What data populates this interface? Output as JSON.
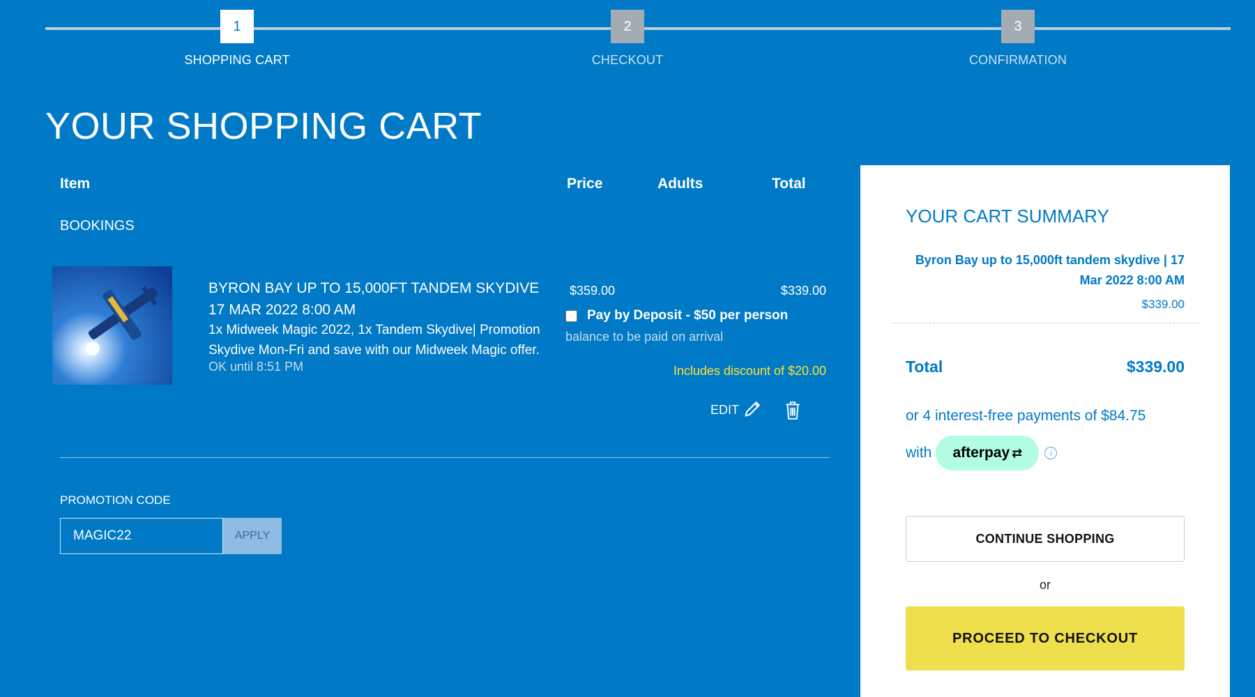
{
  "steps": [
    {
      "number": "1",
      "label": "SHOPPING CART",
      "active": true
    },
    {
      "number": "2",
      "label": "CHECKOUT",
      "active": false
    },
    {
      "number": "3",
      "label": "CONFIRMATION",
      "active": false
    }
  ],
  "page_title": "YOUR SHOPPING CART",
  "table": {
    "col_item": "Item",
    "col_price": "Price",
    "col_adults": "Adults",
    "col_total": "Total",
    "section_label": "BOOKINGS"
  },
  "item": {
    "title_line1": "BYRON BAY UP TO 15,000FT TANDEM SKYDIVE",
    "title_line2": "17 MAR 2022 8:00 AM",
    "description": "1x Midweek Magic 2022, 1x Tandem Skydive| Promotion Skydive Mon-Fri and save with our Midweek Magic offer.",
    "hold_note": "OK until 8:51 PM",
    "price": "$359.00",
    "total": "$339.00",
    "deposit_label": "Pay by Deposit - $50 per person",
    "deposit_checked": false,
    "deposit_note": "balance to be paid on arrival",
    "discount_note": "Includes discount of $20.00",
    "edit_label": "EDIT"
  },
  "promo": {
    "label": "PROMOTION CODE",
    "value": "MAGIC22",
    "apply_label": "APPLY"
  },
  "summary": {
    "title": "YOUR CART SUMMARY",
    "item_name": "Byron Bay up to 15,000ft tandem skydive | 17 Mar 2022 8:00 AM",
    "item_price": "$339.00",
    "total_label": "Total",
    "total_value": "$339.00",
    "afterpay_text": "or 4 interest-free payments of $84.75",
    "with_label": "with",
    "afterpay_brand": "afterpay",
    "continue_label": "CONTINUE SHOPPING",
    "or_label": "or",
    "checkout_label": "PROCEED TO CHECKOUT"
  },
  "colors": {
    "background": "#0079c6",
    "accent_yellow": "#f0df4d",
    "discount_yellow": "#ffe135",
    "afterpay_mint": "#b2fce4"
  }
}
